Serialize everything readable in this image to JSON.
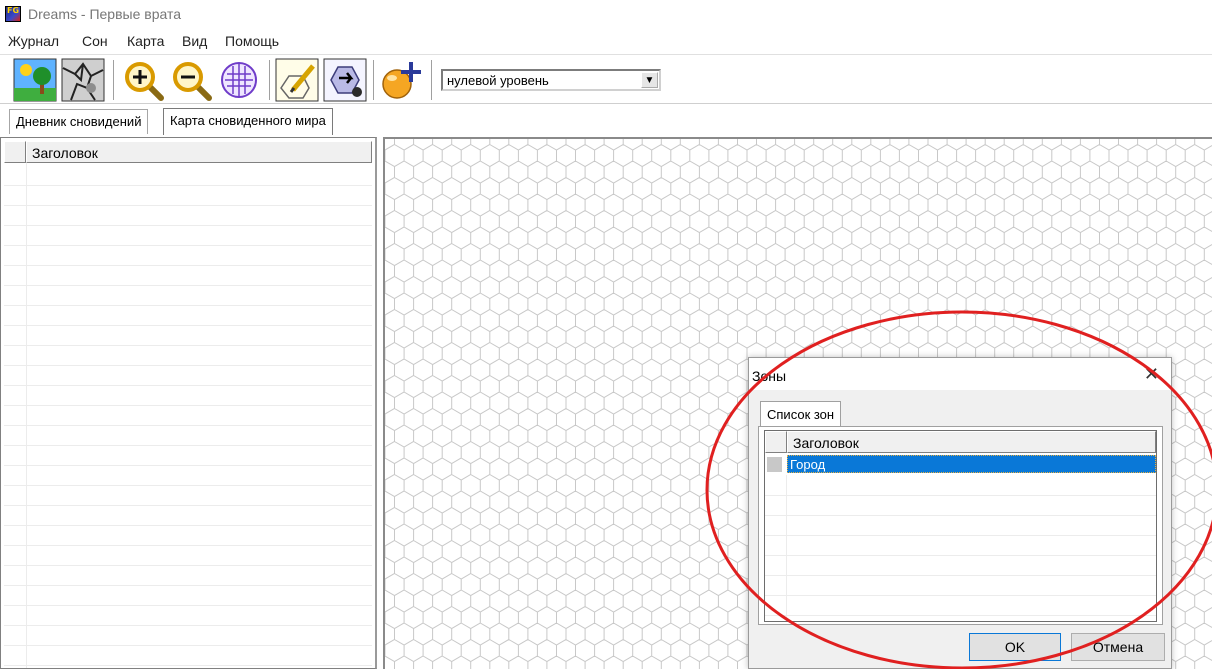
{
  "window": {
    "title": "Dreams - Первые врата"
  },
  "menu": {
    "items": [
      "Журнал",
      "Сон",
      "Карта",
      "Вид",
      "Помощь"
    ]
  },
  "toolbar": {
    "level_select": {
      "value": "нулевой уровень"
    }
  },
  "tabs": [
    "Дневник сновидений",
    "Карта сновиденного мира"
  ],
  "left_panel": {
    "column_header": "Заголовок"
  },
  "zones_dialog": {
    "title": "Зоны",
    "tab": "Список зон",
    "column_header": "Заголовок",
    "rows": [
      "Город"
    ],
    "ok_label": "OK",
    "cancel_label": "Отмена"
  },
  "colors": {
    "selection": "#0a78d7",
    "annotation": "#e02020",
    "hex_grid": "#c8c8c8"
  }
}
